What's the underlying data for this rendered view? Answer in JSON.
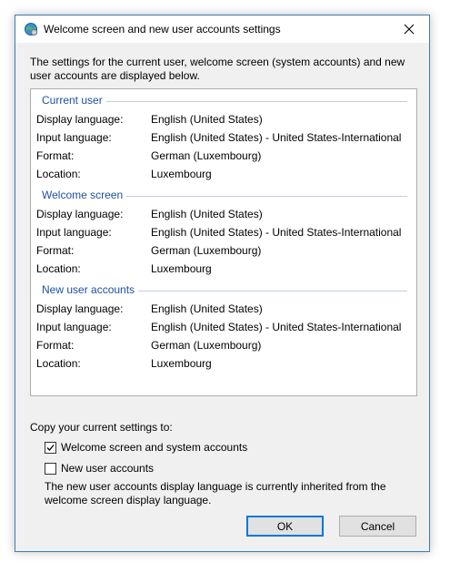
{
  "window": {
    "title": "Welcome screen and new user accounts settings",
    "icon": "globe-settings-icon",
    "close_icon": "close-icon"
  },
  "intro": "The settings for the current user, welcome screen (system accounts) and new user accounts are displayed below.",
  "groups": [
    {
      "title": "Current user",
      "rows": [
        {
          "label": "Display language:",
          "value": "English (United States)"
        },
        {
          "label": "Input language:",
          "value": "English (United States) - United States-International"
        },
        {
          "label": "Format:",
          "value": "German (Luxembourg)"
        },
        {
          "label": "Location:",
          "value": "Luxembourg"
        }
      ]
    },
    {
      "title": "Welcome screen",
      "rows": [
        {
          "label": "Display language:",
          "value": "English (United States)"
        },
        {
          "label": "Input language:",
          "value": "English (United States) - United States-International"
        },
        {
          "label": "Format:",
          "value": "German (Luxembourg)"
        },
        {
          "label": "Location:",
          "value": "Luxembourg"
        }
      ]
    },
    {
      "title": "New user accounts",
      "rows": [
        {
          "label": "Display language:",
          "value": "English (United States)"
        },
        {
          "label": "Input language:",
          "value": "English (United States) - United States-International"
        },
        {
          "label": "Format:",
          "value": "German (Luxembourg)"
        },
        {
          "label": "Location:",
          "value": "Luxembourg"
        }
      ]
    }
  ],
  "copy": {
    "label": "Copy your current settings to:",
    "welcome_checkbox": {
      "label": "Welcome screen and system accounts",
      "checked": true
    },
    "newuser_checkbox": {
      "label": "New user accounts",
      "checked": false
    },
    "note": "The new user accounts display language is currently inherited from the welcome screen display language."
  },
  "buttons": {
    "ok": "OK",
    "cancel": "Cancel"
  },
  "colors": {
    "accent": "#0078d7",
    "group_title": "#1e50a0",
    "window_border": "#3c7fb1",
    "dialog_bg": "#f0f0f0"
  }
}
